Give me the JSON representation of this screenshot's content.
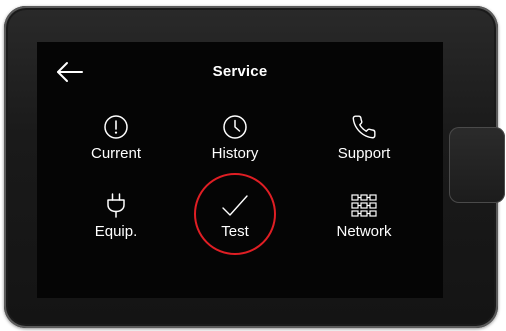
{
  "header": {
    "title": "Service"
  },
  "tiles": [
    {
      "label": "Current",
      "icon": "exclamation-circle-icon"
    },
    {
      "label": "History",
      "icon": "clock-icon"
    },
    {
      "label": "Support",
      "icon": "phone-icon"
    },
    {
      "label": "Equip.",
      "icon": "plug-icon"
    },
    {
      "label": "Test",
      "icon": "checkmark-icon"
    },
    {
      "label": "Network",
      "icon": "network-grid-icon"
    }
  ],
  "colors": {
    "screen_background": "#050505",
    "text": "#ffffff",
    "highlight_ring": "#e01e24",
    "bezel": "#1a1a1a"
  }
}
